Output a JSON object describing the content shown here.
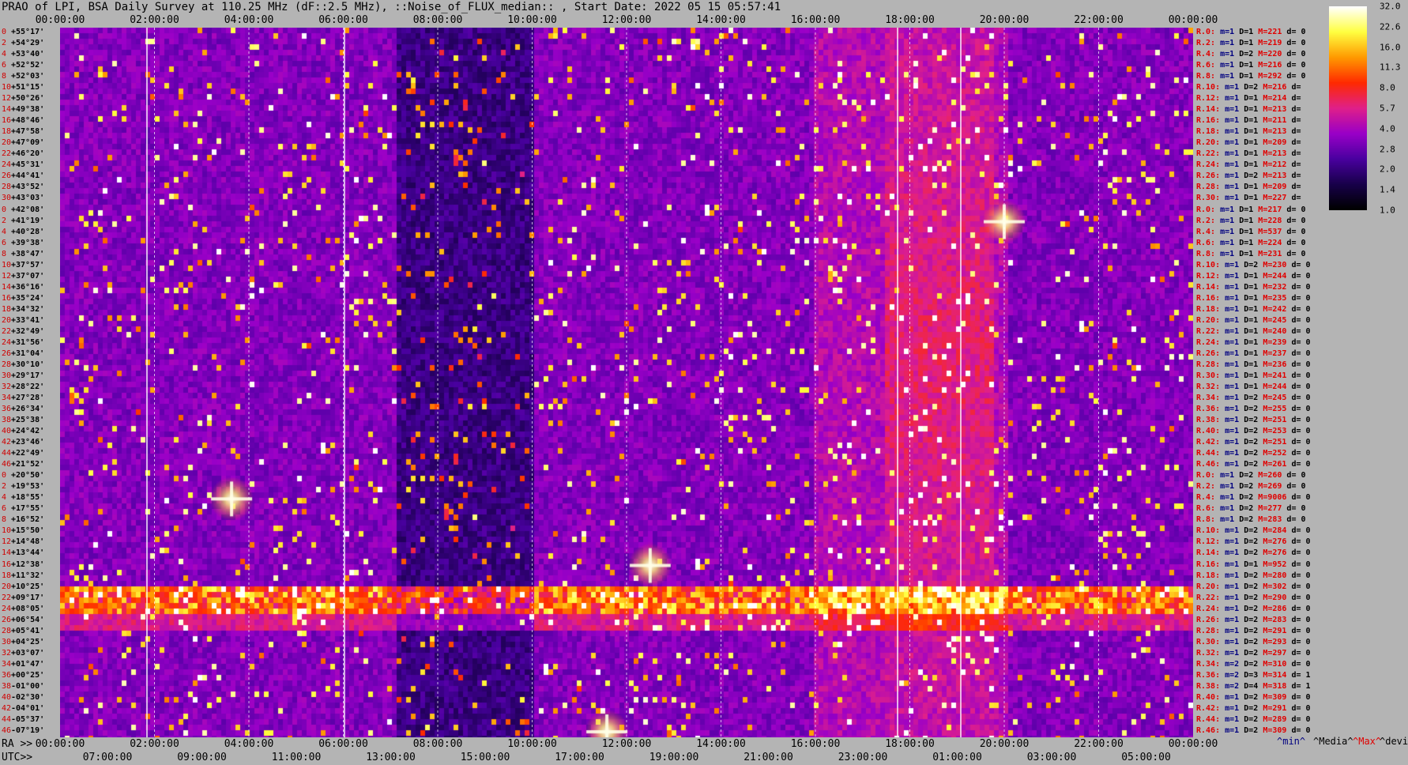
{
  "title": "PRAO of LPI, BSA Daily Survey at 110.25 MHz (dF::2.5 MHz), ::Noise_of_FLUX_median:: , Start Date: 2022 05 15 05:57:41",
  "chart_data": {
    "type": "heatmap",
    "title": "PRAO of LPI, BSA Daily Survey at 110.25 MHz (dF::2.5 MHz), ::Noise_of_FLUX_median:: , Start Date: 2022 05 15 05:57:41",
    "x_top_label": "",
    "x_top_ticks": [
      "00:00:00",
      "02:00:00",
      "04:00:00",
      "06:00:00",
      "08:00:00",
      "10:00:00",
      "12:00:00",
      "14:00:00",
      "16:00:00",
      "18:00:00",
      "20:00:00",
      "22:00:00",
      "00:00:00"
    ],
    "x_bottom_ra_label": "RA >>",
    "x_bottom_ra_ticks": [
      "00:00:00",
      "02:00:00",
      "04:00:00",
      "06:00:00",
      "08:00:00",
      "10:00:00",
      "12:00:00",
      "14:00:00",
      "16:00:00",
      "18:00:00",
      "20:00:00",
      "22:00:00",
      "00:00:00"
    ],
    "x_bottom_utc_label": "UTC>>",
    "x_bottom_utc_ticks": [
      "07:00:00",
      "09:00:00",
      "11:00:00",
      "13:00:00",
      "15:00:00",
      "17:00:00",
      "19:00:00",
      "21:00:00",
      "23:00:00",
      "01:00:00",
      "03:00:00",
      "05:00:00"
    ],
    "y_declinations": [
      "+55°17'",
      "+54°29'",
      "+53°40'",
      "+52°52'",
      "+52°03'",
      "+51°15'",
      "+50°26'",
      "+49°38'",
      "+48°46'",
      "+47°58'",
      "+47°09'",
      "+46°20'",
      "+45°31'",
      "+44°41'",
      "+43°52'",
      "+43°03'",
      "+42°08'",
      "+41°19'",
      "+40°28'",
      "+39°38'",
      "+38°47'",
      "+37°57'",
      "+37°07'",
      "+36°16'",
      "+35°24'",
      "+34°32'",
      "+33°41'",
      "+32°49'",
      "+31°56'",
      "+31°04'",
      "+30°10'",
      "+29°17'",
      "+28°22'",
      "+27°28'",
      "+26°34'",
      "+25°38'",
      "+24°42'",
      "+23°46'",
      "+22°49'",
      "+21°52'",
      "+20°50'",
      "+19°53'",
      "+18°55'",
      "+17°55'",
      "+16°52'",
      "+15°50'",
      "+14°48'",
      "+13°44'",
      "+12°38'",
      "+11°32'",
      "+10°25'",
      "+09°17'",
      "+08°05'",
      "+06°54'",
      "+05°41'",
      "+04°25'",
      "+03°07'",
      "+01°47'",
      "+00°25'",
      "-01°00'",
      "-02°30'",
      "-04°01'",
      "-05°37'",
      "-07°19'"
    ],
    "y_index": [
      "0",
      "2",
      "4",
      "6",
      "8",
      "10",
      "12",
      "14",
      "16",
      "18",
      "20",
      "22",
      "24",
      "26",
      "28",
      "30",
      "0",
      "2",
      "4",
      "6",
      "8",
      "10",
      "12",
      "14",
      "16",
      "18",
      "20",
      "22",
      "24",
      "26",
      "28",
      "30",
      "32",
      "34",
      "36",
      "38",
      "40",
      "42",
      "44",
      "46",
      "0",
      "2",
      "4",
      "6",
      "8",
      "10",
      "12",
      "14",
      "16",
      "18",
      "20",
      "22",
      "24",
      "26",
      "28",
      "30",
      "32",
      "34",
      "36",
      "38",
      "40",
      "42",
      "44",
      "46"
    ],
    "colorbar": {
      "scale": "log",
      "ticks": [
        "32.0",
        "22.6",
        "16.0",
        "11.3",
        "8.0",
        "5.7",
        "4.0",
        "2.8",
        "2.0",
        "1.4",
        "1.0"
      ],
      "min": 1.0,
      "max": 32.0,
      "colors": [
        "#000000",
        "#18004a",
        "#4a00a0",
        "#9a00c8",
        "#e0208a",
        "#ff2a00",
        "#ff9a00",
        "#ffff40",
        "#ffffff"
      ]
    },
    "bright_sources": [
      {
        "ra": "03:38",
        "dec": "+18°55'",
        "label": "strong source"
      },
      {
        "ra": "20:00",
        "dec": "+41°19'",
        "label": "strong source"
      },
      {
        "ra": "11:35",
        "dec": "-07°19'",
        "label": "source"
      },
      {
        "ra": "12:30",
        "dec": "+12°38'",
        "label": "source"
      }
    ],
    "rows": [
      {
        "r": "R.0:",
        "m": "m=1",
        "d": "D=1",
        "med": "M=221",
        "dev": "d= 0"
      },
      {
        "r": "R.2:",
        "m": "m=1",
        "d": "D=1",
        "med": "M=219",
        "dev": "d= 0"
      },
      {
        "r": "R.4:",
        "m": "m=1",
        "d": "D=2",
        "med": "M=220",
        "dev": "d= 0"
      },
      {
        "r": "R.6:",
        "m": "m=1",
        "d": "D=1",
        "med": "M=216",
        "dev": "d= 0"
      },
      {
        "r": "R.8:",
        "m": "m=1",
        "d": "D=1",
        "med": "M=292",
        "dev": "d= 0"
      },
      {
        "r": "R.10:",
        "m": "m=1",
        "d": "D=2",
        "med": "M=216",
        "dev": "d="
      },
      {
        "r": "R.12:",
        "m": "m=1",
        "d": "D=1",
        "med": "M=214",
        "dev": "d="
      },
      {
        "r": "R.14:",
        "m": "m=1",
        "d": "D=1",
        "med": "M=213",
        "dev": "d="
      },
      {
        "r": "R.16:",
        "m": "m=1",
        "d": "D=1",
        "med": "M=211",
        "dev": "d="
      },
      {
        "r": "R.18:",
        "m": "m=1",
        "d": "D=1",
        "med": "M=213",
        "dev": "d="
      },
      {
        "r": "R.20:",
        "m": "m=1",
        "d": "D=1",
        "med": "M=209",
        "dev": "d="
      },
      {
        "r": "R.22:",
        "m": "m=1",
        "d": "D=1",
        "med": "M=213",
        "dev": "d="
      },
      {
        "r": "R.24:",
        "m": "m=1",
        "d": "D=1",
        "med": "M=212",
        "dev": "d="
      },
      {
        "r": "R.26:",
        "m": "m=1",
        "d": "D=2",
        "med": "M=213",
        "dev": "d="
      },
      {
        "r": "R.28:",
        "m": "m=1",
        "d": "D=1",
        "med": "M=209",
        "dev": "d="
      },
      {
        "r": "R.30:",
        "m": "m=1",
        "d": "D=1",
        "med": "M=227",
        "dev": "d="
      },
      {
        "r": "R.0:",
        "m": "m=1",
        "d": "D=1",
        "med": "M=217",
        "dev": "d= 0"
      },
      {
        "r": "R.2:",
        "m": "m=1",
        "d": "D=1",
        "med": "M=228",
        "dev": "d= 0"
      },
      {
        "r": "R.4:",
        "m": "m=1",
        "d": "D=1",
        "med": "M=537",
        "dev": "d= 0"
      },
      {
        "r": "R.6:",
        "m": "m=1",
        "d": "D=1",
        "med": "M=224",
        "dev": "d= 0"
      },
      {
        "r": "R.8:",
        "m": "m=1",
        "d": "D=1",
        "med": "M=231",
        "dev": "d= 0"
      },
      {
        "r": "R.10:",
        "m": "m=1",
        "d": "D=2",
        "med": "M=230",
        "dev": "d= 0"
      },
      {
        "r": "R.12:",
        "m": "m=1",
        "d": "D=1",
        "med": "M=244",
        "dev": "d= 0"
      },
      {
        "r": "R.14:",
        "m": "m=1",
        "d": "D=1",
        "med": "M=232",
        "dev": "d= 0"
      },
      {
        "r": "R.16:",
        "m": "m=1",
        "d": "D=1",
        "med": "M=235",
        "dev": "d= 0"
      },
      {
        "r": "R.18:",
        "m": "m=1",
        "d": "D=1",
        "med": "M=242",
        "dev": "d= 0"
      },
      {
        "r": "R.20:",
        "m": "m=1",
        "d": "D=1",
        "med": "M=245",
        "dev": "d= 0"
      },
      {
        "r": "R.22:",
        "m": "m=1",
        "d": "D=1",
        "med": "M=240",
        "dev": "d= 0"
      },
      {
        "r": "R.24:",
        "m": "m=1",
        "d": "D=1",
        "med": "M=239",
        "dev": "d= 0"
      },
      {
        "r": "R.26:",
        "m": "m=1",
        "d": "D=1",
        "med": "M=237",
        "dev": "d= 0"
      },
      {
        "r": "R.28:",
        "m": "m=1",
        "d": "D=1",
        "med": "M=236",
        "dev": "d= 0"
      },
      {
        "r": "R.30:",
        "m": "m=1",
        "d": "D=1",
        "med": "M=241",
        "dev": "d= 0"
      },
      {
        "r": "R.32:",
        "m": "m=1",
        "d": "D=1",
        "med": "M=244",
        "dev": "d= 0"
      },
      {
        "r": "R.34:",
        "m": "m=1",
        "d": "D=2",
        "med": "M=245",
        "dev": "d= 0"
      },
      {
        "r": "R.36:",
        "m": "m=1",
        "d": "D=2",
        "med": "M=255",
        "dev": "d= 0"
      },
      {
        "r": "R.38:",
        "m": "m=1",
        "d": "D=2",
        "med": "M=251",
        "dev": "d= 0"
      },
      {
        "r": "R.40:",
        "m": "m=1",
        "d": "D=2",
        "med": "M=253",
        "dev": "d= 0"
      },
      {
        "r": "R.42:",
        "m": "m=1",
        "d": "D=2",
        "med": "M=251",
        "dev": "d= 0"
      },
      {
        "r": "R.44:",
        "m": "m=1",
        "d": "D=2",
        "med": "M=252",
        "dev": "d= 0"
      },
      {
        "r": "R.46:",
        "m": "m=1",
        "d": "D=2",
        "med": "M=261",
        "dev": "d= 0"
      },
      {
        "r": "R.0:",
        "m": "m=1",
        "d": "D=2",
        "med": "M=260",
        "dev": "d= 0"
      },
      {
        "r": "R.2:",
        "m": "m=1",
        "d": "D=2",
        "med": "M=269",
        "dev": "d= 0"
      },
      {
        "r": "R.4:",
        "m": "m=1",
        "d": "D=2",
        "med": "M=9006",
        "dev": "d= 0"
      },
      {
        "r": "R.6:",
        "m": "m=1",
        "d": "D=2",
        "med": "M=277",
        "dev": "d= 0"
      },
      {
        "r": "R.8:",
        "m": "m=1",
        "d": "D=2",
        "med": "M=283",
        "dev": "d= 0"
      },
      {
        "r": "R.10:",
        "m": "m=1",
        "d": "D=2",
        "med": "M=284",
        "dev": "d= 0"
      },
      {
        "r": "R.12:",
        "m": "m=1",
        "d": "D=2",
        "med": "M=276",
        "dev": "d= 0"
      },
      {
        "r": "R.14:",
        "m": "m=1",
        "d": "D=2",
        "med": "M=276",
        "dev": "d= 0"
      },
      {
        "r": "R.16:",
        "m": "m=1",
        "d": "D=1",
        "med": "M=952",
        "dev": "d= 0"
      },
      {
        "r": "R.18:",
        "m": "m=1",
        "d": "D=2",
        "med": "M=280",
        "dev": "d= 0"
      },
      {
        "r": "R.20:",
        "m": "m=1",
        "d": "D=2",
        "med": "M=302",
        "dev": "d= 0"
      },
      {
        "r": "R.22:",
        "m": "m=1",
        "d": "D=2",
        "med": "M=290",
        "dev": "d= 0"
      },
      {
        "r": "R.24:",
        "m": "m=1",
        "d": "D=2",
        "med": "M=286",
        "dev": "d= 0"
      },
      {
        "r": "R.26:",
        "m": "m=1",
        "d": "D=2",
        "med": "M=283",
        "dev": "d= 0"
      },
      {
        "r": "R.28:",
        "m": "m=1",
        "d": "D=2",
        "med": "M=291",
        "dev": "d= 0"
      },
      {
        "r": "R.30:",
        "m": "m=1",
        "d": "D=2",
        "med": "M=293",
        "dev": "d= 0"
      },
      {
        "r": "R.32:",
        "m": "m=1",
        "d": "D=2",
        "med": "M=297",
        "dev": "d= 0"
      },
      {
        "r": "R.34:",
        "m": "m=2",
        "d": "D=2",
        "med": "M=310",
        "dev": "d= 0"
      },
      {
        "r": "R.36:",
        "m": "m=2",
        "d": "D=3",
        "med": "M=314",
        "dev": "d= 1"
      },
      {
        "r": "R.38:",
        "m": "m=2",
        "d": "D=4",
        "med": "M=318",
        "dev": "d= 1"
      },
      {
        "r": "R.40:",
        "m": "m=1",
        "d": "D=2",
        "med": "M=309",
        "dev": "d= 0"
      },
      {
        "r": "R.42:",
        "m": "m=1",
        "d": "D=2",
        "med": "M=291",
        "dev": "d= 0"
      },
      {
        "r": "R.44:",
        "m": "m=1",
        "d": "D=2",
        "med": "M=289",
        "dev": "d= 0"
      },
      {
        "r": "R.46:",
        "m": "m=1",
        "d": "D=2",
        "med": "M=309",
        "dev": "d= 0"
      }
    ],
    "legend": {
      "min": "^min^",
      "median": "^Media^",
      "max": "^Max^",
      "dev": "^devia^"
    }
  }
}
